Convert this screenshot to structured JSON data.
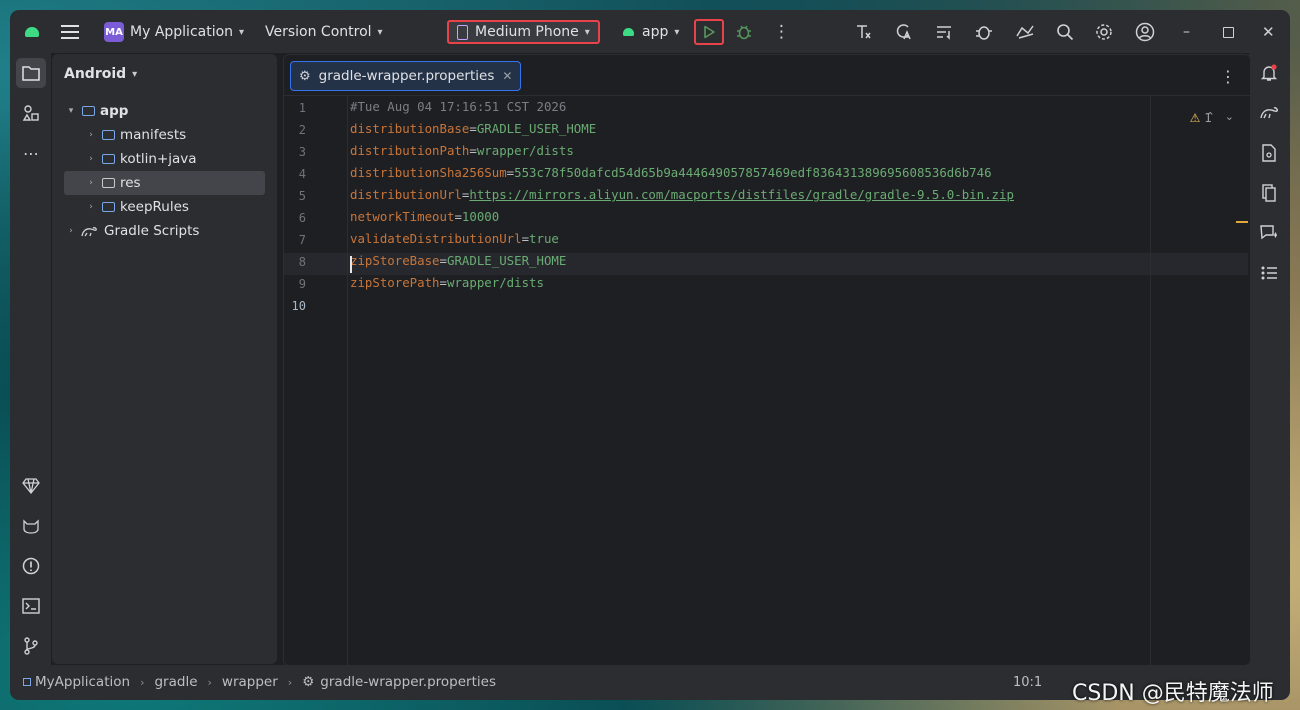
{
  "titlebar": {
    "project_badge": "MA",
    "project_name": "My Application",
    "vcs": "Version Control",
    "device": "Medium Phone",
    "run_config": "app",
    "more": "⋮"
  },
  "project_panel": {
    "view": "Android",
    "tree": [
      {
        "label": "app",
        "level": 0,
        "expanded": true
      },
      {
        "label": "manifests",
        "level": 1
      },
      {
        "label": "kotlin+java",
        "level": 1
      },
      {
        "label": "res",
        "level": 1,
        "selected": true
      },
      {
        "label": "keepRules",
        "level": 1
      },
      {
        "label": "Gradle Scripts",
        "level": 0
      }
    ]
  },
  "editor": {
    "tab": "gradle-wrapper.properties",
    "warning_count": "1",
    "line_numbers": [
      "1",
      "2",
      "3",
      "4",
      "5",
      "6",
      "7",
      "8",
      "9",
      "10"
    ],
    "lines": [
      {
        "comment": "#Tue Aug 04 17:16:51 CST 2026"
      },
      {
        "key": "distributionBase",
        "value": "GRADLE_USER_HOME"
      },
      {
        "key": "distributionPath",
        "value": "wrapper/dists"
      },
      {
        "key": "distributionSha256Sum",
        "value": "553c78f50dafcd54d65b9a444649057857469edf836431389695608536d6b746"
      },
      {
        "key": "distributionUrl",
        "value": "https://mirrors.aliyun.com/macports/distfiles/gradle/gradle-9.5.0-bin.zip",
        "link": true
      },
      {
        "key": "networkTimeout",
        "value": "10000"
      },
      {
        "key": "validateDistributionUrl",
        "value": "true"
      },
      {
        "key": "zipStoreBase",
        "value": "GRADLE_USER_HOME"
      },
      {
        "key": "zipStorePath",
        "value": "wrapper/dists"
      },
      {
        "empty": true
      }
    ]
  },
  "status": {
    "breadcrumb": [
      "MyApplication",
      "gradle",
      "wrapper",
      "gradle-wrapper.properties"
    ],
    "cursor": "10:1"
  },
  "watermark": "CSDN @民特魔法师",
  "colors": {
    "accent": "#3574f0",
    "highlight": "#e8434b",
    "android": "#3ddc84"
  }
}
